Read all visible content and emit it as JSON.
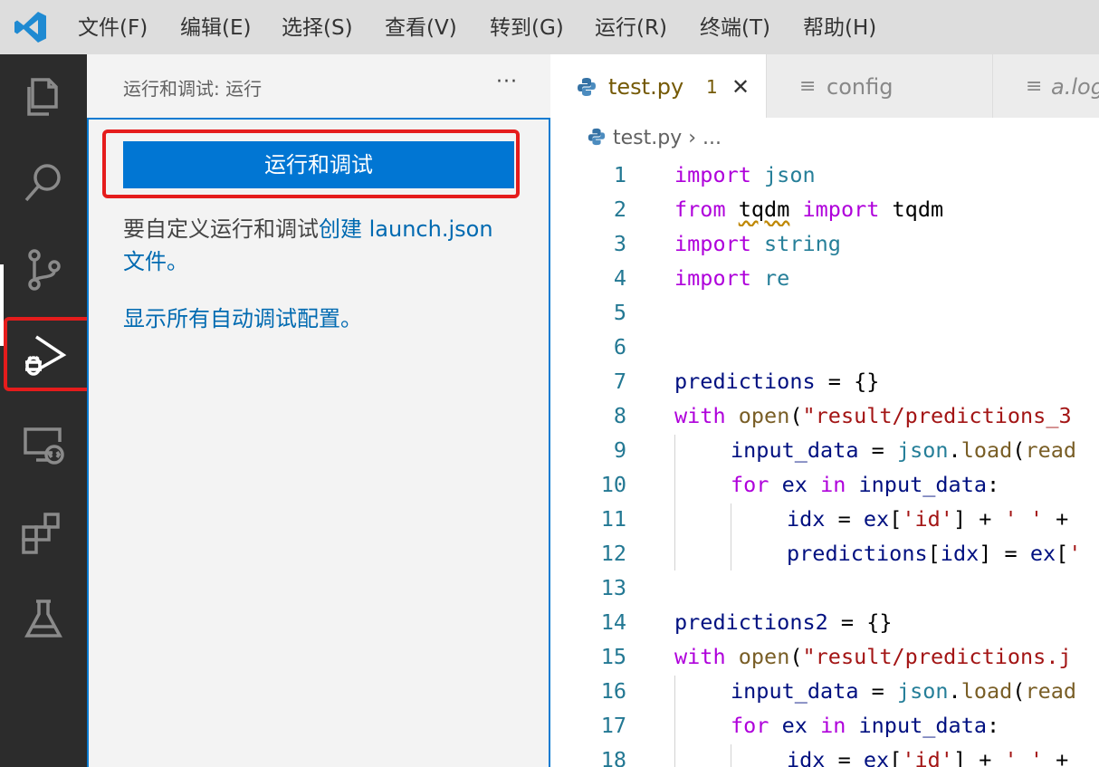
{
  "menubar": {
    "items": [
      "文件(F)",
      "编辑(E)",
      "选择(S)",
      "查看(V)",
      "转到(G)",
      "运行(R)",
      "终端(T)",
      "帮助(H)"
    ]
  },
  "activity_bar": {
    "icons": [
      "explorer-icon",
      "search-icon",
      "source-control-icon",
      "run-debug-icon",
      "remote-explorer-icon",
      "extensions-icon",
      "testing-icon"
    ],
    "active": "run-debug-icon"
  },
  "sidebar": {
    "title": "运行和调试: 运行",
    "more": "···",
    "run_button": "运行和调试",
    "info_prefix": "要自定义运行和调试",
    "info_link": "创建 launch.json",
    "info_suffix": "文件。",
    "show_all": "显示所有自动调试配置。"
  },
  "tabs": [
    {
      "label": "test.py",
      "badge": "1",
      "close": "✕",
      "active": true
    },
    {
      "label": "config",
      "active": false
    },
    {
      "label": "a.log",
      "active": false
    }
  ],
  "breadcrumb": {
    "file": "test.py",
    "sep": "›",
    "rest": "..."
  },
  "code": {
    "line_numbers": [
      "1",
      "2",
      "3",
      "4",
      "5",
      "6",
      "7",
      "8",
      "9",
      "10",
      "11",
      "12",
      "13",
      "14",
      "15",
      "16",
      "17",
      "18"
    ],
    "l1": [
      "import",
      " json"
    ],
    "l2": [
      "from",
      " ",
      "tqdm",
      " ",
      "import",
      " tqdm"
    ],
    "l3": [
      "import",
      " string"
    ],
    "l4": [
      "import",
      " re"
    ],
    "l7": [
      "predictions",
      " = {}"
    ],
    "l8": [
      "with",
      " ",
      "open",
      "(",
      "\"result/predictions_3"
    ],
    "l9": [
      "input_data",
      " = ",
      "json",
      ".",
      "load",
      "(",
      "read"
    ],
    "l10": [
      "for",
      " ",
      "ex",
      " ",
      "in",
      " ",
      "input_data",
      ":"
    ],
    "l11": [
      "idx",
      " = ",
      "ex",
      "[",
      "'id'",
      "] + ",
      "' '",
      " +"
    ],
    "l12": [
      "predictions",
      "[",
      "idx",
      "] = ",
      "ex",
      "[",
      "'"
    ],
    "l14": [
      "predictions2",
      " = {}"
    ],
    "l15": [
      "with",
      " ",
      "open",
      "(",
      "\"result/predictions.j"
    ],
    "l16": [
      "input_data",
      " = ",
      "json",
      ".",
      "load",
      "(",
      "read"
    ],
    "l17": [
      "for",
      " ",
      "ex",
      " ",
      "in",
      " ",
      "input_data",
      ":"
    ],
    "l18": [
      "idx",
      " = ",
      "ex",
      "[",
      "'id'",
      "] + ",
      "' '",
      " +"
    ]
  },
  "colors": {
    "accent": "#0176d3",
    "highlight": "#e51c1c",
    "activity_bar": "#2c2c2c"
  }
}
